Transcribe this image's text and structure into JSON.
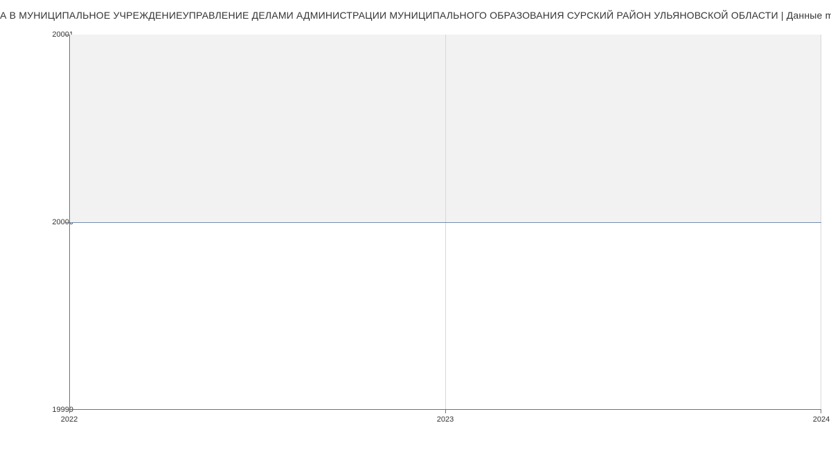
{
  "chart_data": {
    "type": "line",
    "title": "А В МУНИЦИПАЛЬНОЕ УЧРЕЖДЕНИЕУПРАВЛЕНИЕ ДЕЛАМИ АДМИНИСТРАЦИИ МУНИЦИПАЛЬНОГО ОБРАЗОВАНИЯ СУРСКИЙ РАЙОН УЛЬЯНОВСКОЙ ОБЛАСТИ | Данные mno",
    "x": [
      2022,
      2024
    ],
    "values": [
      20000,
      20000
    ],
    "xlabel": "",
    "ylabel": "",
    "xticks": [
      "2022",
      "2023",
      "2024"
    ],
    "yticks": [
      "19999",
      "20000",
      "20001"
    ],
    "xlim": [
      2022,
      2024
    ],
    "ylim": [
      19999,
      20001
    ],
    "line_color": "#5b8fd6"
  }
}
